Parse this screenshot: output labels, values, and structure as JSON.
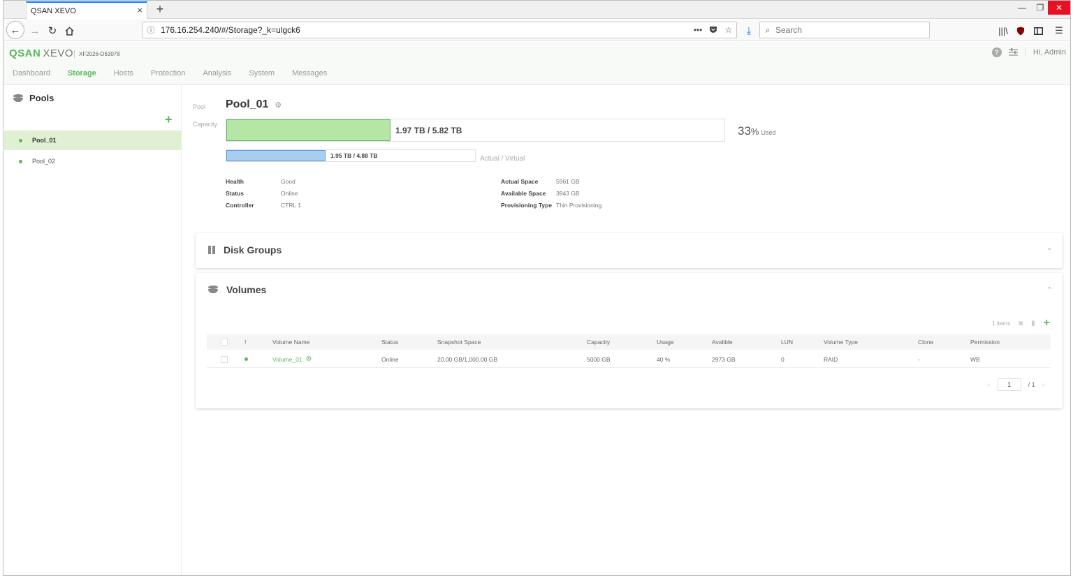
{
  "browser": {
    "tab_title": "QSAN XEVO",
    "tab_close": "×",
    "new_tab": "+",
    "url": "176.16.254.240/#/Storage?_k=ulgck6",
    "search_placeholder": "Search",
    "window_controls": {
      "min": "—",
      "max": "❐",
      "close": "✕"
    }
  },
  "app": {
    "logo_brand": "QSAN",
    "logo_product": "XEVO",
    "serial": "XF2026-D63078",
    "greeting": "Hi, Admin",
    "nav": [
      "Dashboard",
      "Storage",
      "Hosts",
      "Protection",
      "Analysis",
      "System",
      "Messages"
    ],
    "active_nav": "Storage"
  },
  "sidebar": {
    "title": "Pools",
    "add": "+",
    "items": [
      {
        "label": "Pool_01",
        "selected": true
      },
      {
        "label": "Pool_02",
        "selected": false
      }
    ]
  },
  "pool": {
    "pool_label": "Pool",
    "name": "Pool_01",
    "capacity_label": "Capacity",
    "capacity_text": "1.97 TB / 5.82 TB",
    "capacity_fraction": 0.33,
    "used_percent": "33",
    "used_pct_symbol": "%",
    "used_label": "Used",
    "actual_text": "1.95 TB / 4.88 TB",
    "actual_fraction": 0.4,
    "actual_virtual_label": "Actual / Virtual",
    "details_left": [
      {
        "key": "Health",
        "value": "Good"
      },
      {
        "key": "Status",
        "value": "Online"
      },
      {
        "key": "Controller",
        "value": "CTRL 1"
      }
    ],
    "details_right": [
      {
        "key": "Actual Space",
        "value": "5961 GB"
      },
      {
        "key": "Available Space",
        "value": "3943 GB"
      },
      {
        "key": "Provisioning Type",
        "value": "Thin Provisioning"
      }
    ]
  },
  "disk_groups": {
    "title": "Disk Groups",
    "chevron": "⌄"
  },
  "volumes": {
    "title": "Volumes",
    "chevron": "⌃",
    "items_count": "1 items",
    "columns": [
      "!",
      "Volume Name",
      "Status",
      "Snapshot Space",
      "Capacity",
      "Usage",
      "Avalible",
      "LUN",
      "Volume Type",
      "Clone",
      "Permission"
    ],
    "rows": [
      {
        "name": "Volume_01",
        "status": "Online",
        "snapshot_space": "20.00 GB/1,000.00 GB",
        "capacity": "5000 GB",
        "usage": "40 %",
        "available": "2973 GB",
        "lun": "0",
        "volume_type": "RAID",
        "clone": "-",
        "permission": "WB"
      }
    ],
    "pager": {
      "current": "1",
      "total": "/ 1"
    }
  },
  "colors": {
    "accent": "#5cb85c",
    "capacity_fill": "#b6e6a6",
    "actual_fill": "#a9cdf2",
    "selected_bg": "#dff0d3"
  }
}
